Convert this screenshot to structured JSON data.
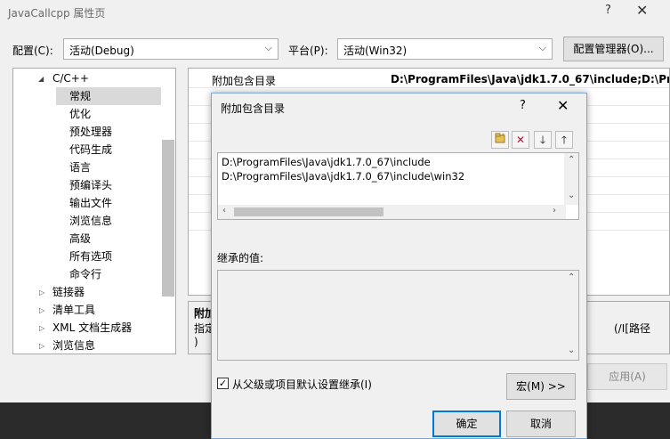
{
  "window": {
    "title": "JavaCallcpp 属性页",
    "help_glyph": "?",
    "close_glyph": "✕"
  },
  "toolbar": {
    "config_label": "配置(C):",
    "config_value": "活动(Debug)",
    "platform_label": "平台(P):",
    "platform_value": "活动(Win32)",
    "config_manager_label": "配置管理器(O)..."
  },
  "tree": {
    "items": [
      {
        "label": "C/C++",
        "arrow": "◢"
      },
      {
        "label": "常规"
      },
      {
        "label": "优化"
      },
      {
        "label": "预处理器"
      },
      {
        "label": "代码生成"
      },
      {
        "label": "语言"
      },
      {
        "label": "预编译头"
      },
      {
        "label": "输出文件"
      },
      {
        "label": "浏览信息"
      },
      {
        "label": "高级"
      },
      {
        "label": "所有选项"
      },
      {
        "label": "命令行"
      },
      {
        "label": "链接器",
        "arrow": "▷"
      },
      {
        "label": "清单工具",
        "arrow": "▷"
      },
      {
        "label": "XML 文档生成器",
        "arrow": "▷"
      },
      {
        "label": "浏览信息",
        "arrow": "▷"
      }
    ]
  },
  "grid": {
    "row1_name": "附加包含目录",
    "row1_value": "D:\\ProgramFiles\\Java\\jdk1.7.0_67\\include;D:\\Pr"
  },
  "description": {
    "title": "附加",
    "line1": "指定",
    "line1_right": "(/I[路径",
    "line2": ")"
  },
  "apply_label": "应用(A)",
  "dialog": {
    "title": "附加包含目录",
    "help_glyph": "?",
    "close_glyph": "✕",
    "paths": [
      "D:\\ProgramFiles\\Java\\jdk1.7.0_67\\include",
      "D:\\ProgramFiles\\Java\\jdk1.7.0_67\\include\\win32"
    ],
    "inherited_label": "继承的值:",
    "inherit_checkbox_label": "从父级或项目默认设置继承(I)",
    "inherit_checked": true,
    "macro_button_label": "宏(M) >>",
    "ok_label": "确定",
    "cancel_label": "取消"
  }
}
